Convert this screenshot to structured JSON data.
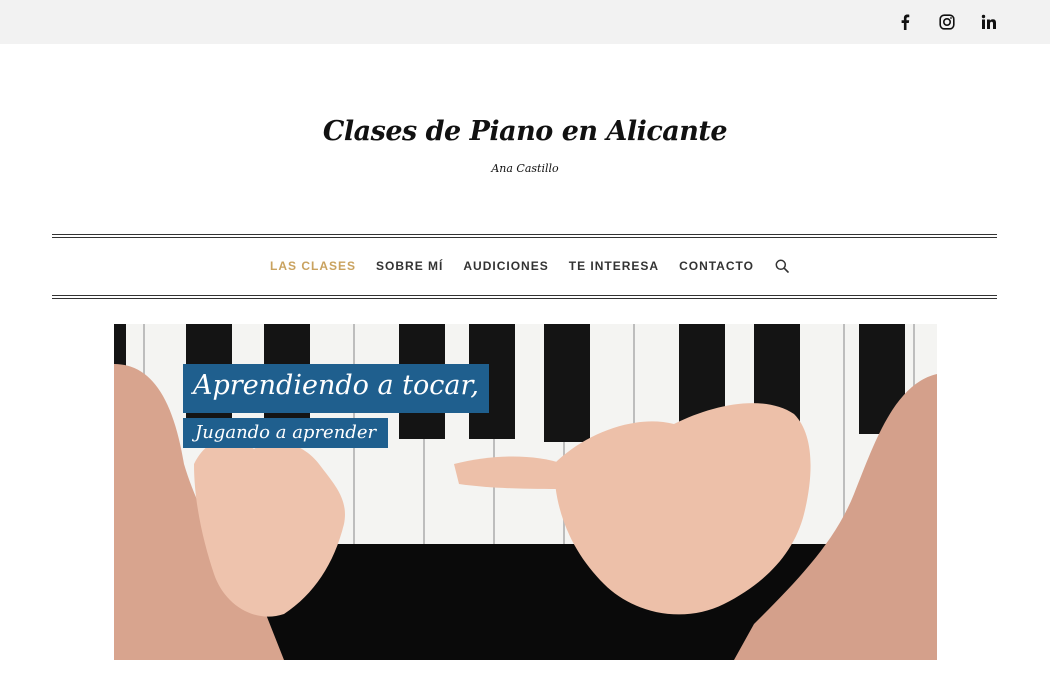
{
  "social": {
    "facebook_icon": "facebook-icon",
    "instagram_icon": "instagram-icon",
    "linkedin_icon": "linkedin-icon"
  },
  "header": {
    "title": "Clases de Piano en Alicante",
    "tagline": "Ana Castillo"
  },
  "nav": {
    "items": [
      {
        "label": "LAS CLASES",
        "active": true
      },
      {
        "label": "SOBRE MÍ",
        "active": false
      },
      {
        "label": "AUDICIONES",
        "active": false
      },
      {
        "label": "TE INTERESA",
        "active": false
      },
      {
        "label": "CONTACTO",
        "active": false
      }
    ],
    "search_icon": "search-icon"
  },
  "hero": {
    "caption_line1": "Aprendiendo a tocar,",
    "caption_line2": "Jugando a aprender"
  },
  "colors": {
    "accent": "#c9a25f",
    "caption_bg": "#1f5f8e",
    "topbar_bg": "#f2f2f2"
  }
}
